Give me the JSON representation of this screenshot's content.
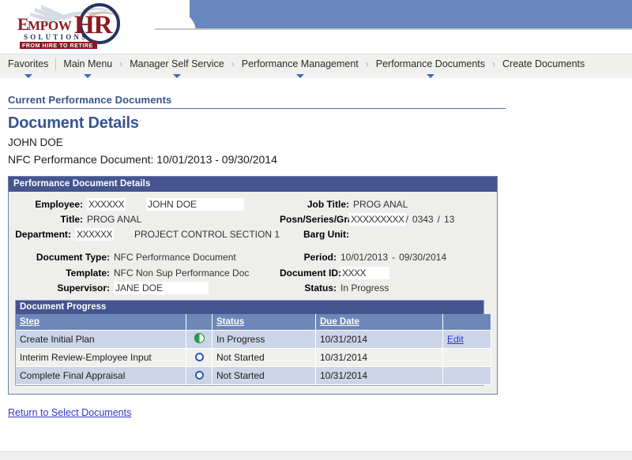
{
  "app": {
    "logo_primary": "EMPOW",
    "logo_accent": "HR",
    "logo_sub": "SOLUTIONS",
    "logo_tagline": "FROM HIRE TO RETIRE",
    "brand_color": "#8e1a21",
    "brand_navy": "#26355f",
    "banner_blue": "#6a87c0"
  },
  "nav": {
    "items": [
      {
        "label": "Favorites",
        "has_menu": true,
        "chevron_after": false
      },
      {
        "label": "Main Menu",
        "has_menu": true,
        "chevron_after": true
      },
      {
        "label": "Manager Self Service",
        "has_menu": true,
        "chevron_after": true
      },
      {
        "label": "Performance Management",
        "has_menu": true,
        "chevron_after": true
      },
      {
        "label": "Performance Documents",
        "has_menu": true,
        "chevron_after": true
      },
      {
        "label": "Create Documents",
        "has_menu": false,
        "chevron_after": false
      }
    ],
    "chevron_glyph": "›"
  },
  "page": {
    "breadcrumb_title": "Current Performance Documents",
    "title": "Document Details",
    "subject": "JOHN DOE",
    "document_line": "NFC Performance Document: 10/01/2013 - 09/30/2014",
    "return_link": "Return to Select Documents"
  },
  "details": {
    "panel_title": "Performance Document Details",
    "labels": {
      "employee": "Employee:",
      "title": "Title:",
      "department": "Department:",
      "job_title": "Job Title:",
      "posn_series_grade": "Posn/Series/Grade",
      "barg_unit": "Barg Unit:",
      "document_type": "Document Type:",
      "template": "Template:",
      "supervisor": "Supervisor:",
      "period": "Period:",
      "document_id": "Document ID:",
      "status": "Status:"
    },
    "values": {
      "employee_id_masked": "XXXXXX",
      "employee_name": "JOHN DOE",
      "title": "PROG ANAL",
      "department_id_masked": "XXXXXX",
      "department_name": "PROJECT CONTROL SECTION 1",
      "job_title": "PROG ANAL",
      "posn_masked": "XXXXXXXXX",
      "series_sep": "/",
      "series": "0343",
      "grade_sep": "/",
      "grade": "13",
      "barg_unit": "",
      "document_type": "NFC Performance Document",
      "template": "NFC Non Sup Performance Doc",
      "supervisor": "JANE DOE",
      "period_start": "10/01/2013",
      "period_dash": "-",
      "period_end": "09/30/2014",
      "document_id_masked": "XXXX",
      "status": "In Progress"
    }
  },
  "progress": {
    "caption": "Document Progress",
    "columns": [
      "Step",
      "",
      "Status",
      "Due Date",
      "",
      ""
    ],
    "rows": [
      {
        "step": "Create Initial Plan",
        "icon": "half-circle-green-icon",
        "status": "In Progress",
        "due_date": "10/31/2014",
        "action": "Edit"
      },
      {
        "step": "Interim Review-Employee Input",
        "icon": "open-circle-blue-icon",
        "status": "Not Started",
        "due_date": "10/31/2014",
        "action": ""
      },
      {
        "step": "Complete Final Appraisal",
        "icon": "open-circle-blue-icon",
        "status": "Not Started",
        "due_date": "10/31/2014",
        "action": ""
      }
    ]
  }
}
